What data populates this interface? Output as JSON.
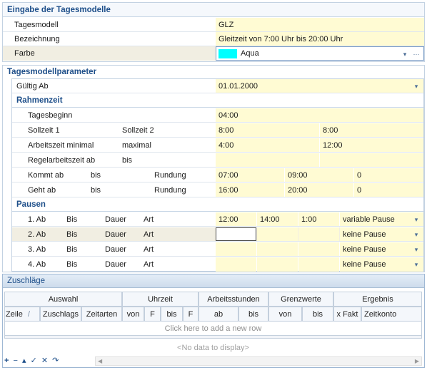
{
  "eingabe": {
    "title": "Eingabe der Tagesmodelle",
    "rows": [
      {
        "label": "Tagesmodell",
        "value": "GLZ"
      },
      {
        "label": "Bezeichnung",
        "value": "Gleitzeit von 7:00 Uhr bis 20:00 Uhr"
      },
      {
        "label": "Farbe",
        "value": "Aqua",
        "swatch": "#00ffff"
      }
    ]
  },
  "params": {
    "title": "Tagesmodellparameter",
    "gueltig": {
      "label": "Gültig Ab",
      "value": "01.01.2000"
    },
    "rahmen": {
      "title": "Rahmenzeit",
      "tagesbeginn": {
        "label": "Tagesbeginn",
        "value": "04:00"
      },
      "sollzeit": {
        "label1": "Sollzeit 1",
        "label2": "Sollzeit 2",
        "value1": "8:00",
        "value2": "8:00"
      },
      "arbeitszeit": {
        "label1": "Arbeitszeit minimal",
        "label2": "maximal",
        "value1": "4:00",
        "value2": "12:00"
      },
      "regel": {
        "label1": "Regelarbeitszeit ab",
        "label2": "bis"
      },
      "kommt": {
        "label1": "Kommt ab",
        "label2": "bis",
        "label3": "Rundung",
        "v1": "07:00",
        "v2": "09:00",
        "v3": "0"
      },
      "geht": {
        "label1": "Geht ab",
        "label2": "bis",
        "label3": "Rundung",
        "v1": "16:00",
        "v2": "20:00",
        "v3": "0"
      }
    },
    "pausen": {
      "title": "Pausen",
      "rows": [
        {
          "ab": "1. Ab",
          "bis": "Bis",
          "dauer": "Dauer",
          "art": "Art",
          "v_ab": "12:00",
          "v_bis": "14:00",
          "v_dauer": "1:00",
          "v_art": "variable Pause"
        },
        {
          "ab": "2. Ab",
          "bis": "Bis",
          "dauer": "Dauer",
          "art": "Art",
          "v_ab": "",
          "v_bis": "",
          "v_dauer": "",
          "v_art": "keine Pause"
        },
        {
          "ab": "3. Ab",
          "bis": "Bis",
          "dauer": "Dauer",
          "art": "Art",
          "v_ab": "",
          "v_bis": "",
          "v_dauer": "",
          "v_art": "keine Pause"
        },
        {
          "ab": "4. Ab",
          "bis": "Bis",
          "dauer": "Dauer",
          "art": "Art",
          "v_ab": "",
          "v_bis": "",
          "v_dauer": "",
          "v_art": "keine Pause"
        }
      ]
    }
  },
  "zuschlaege": {
    "title": "Zuschläge",
    "groups": [
      "Auswahl",
      "Uhrzeit",
      "Arbeitsstunden",
      "Grenzwerte",
      "Ergebnis"
    ],
    "columns": [
      "Zeile",
      "Zuschlags",
      "Zeitarten",
      "von",
      "F",
      "bis",
      "F",
      "ab",
      "bis",
      "von",
      "bis",
      "x Fakt",
      "Zeitkonto"
    ],
    "sort_indicator": "/",
    "add_row": "Click here to add a new row",
    "no_data": "<No data to display>"
  },
  "icons": {
    "dropdown": "▾",
    "ellipsis": "···",
    "nav": [
      "+",
      "−",
      "▴",
      "✓",
      "✕",
      "↷"
    ]
  },
  "colors": {
    "header_text": "#1e4f8a",
    "value_bg": "#fffbd3",
    "border": "#a9bfd6",
    "selected_row": "#f1eee2"
  }
}
